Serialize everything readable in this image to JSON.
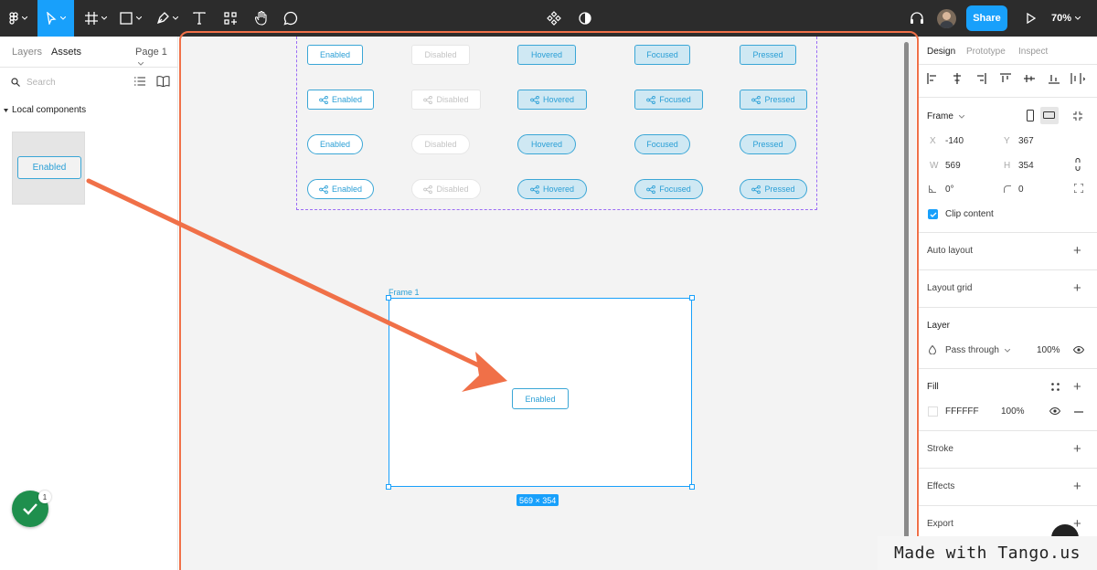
{
  "toolbar": {
    "tools": [
      "figma-menu-icon",
      "move-tool-icon",
      "frame-tool-icon",
      "shape-tool-icon",
      "pen-tool-icon",
      "text-tool-icon",
      "resources-icon",
      "hand-tool-icon",
      "comment-icon"
    ],
    "center_icons": [
      "component-icon",
      "theme-contrast-icon"
    ],
    "share_label": "Share",
    "zoom": "70%"
  },
  "left_panel": {
    "tabs": [
      "Layers",
      "Assets"
    ],
    "page": "Page 1",
    "search_placeholder": "Search",
    "section": "Local components",
    "component_label": "Enabled",
    "notification_count": "1"
  },
  "canvas": {
    "variant_rows": [
      {
        "style": "rect",
        "icon": false,
        "labels": [
          "Enabled",
          "Disabled",
          "Hovered",
          "Focused",
          "Pressed"
        ]
      },
      {
        "style": "rect",
        "icon": true,
        "labels": [
          "Enabled",
          "Disabled",
          "Hovered",
          "Focused",
          "Pressed"
        ]
      },
      {
        "style": "pill",
        "icon": false,
        "labels": [
          "Enabled",
          "Disabled",
          "Hovered",
          "Focused",
          "Pressed"
        ]
      },
      {
        "style": "pill",
        "icon": true,
        "labels": [
          "Enabled",
          "Disabled",
          "Hovered",
          "Focused",
          "Pressed"
        ]
      }
    ],
    "frame_name": "Frame 1",
    "frame_button": "Enabled",
    "frame_dims": "569 × 354"
  },
  "right_panel": {
    "tabs": [
      "Design",
      "Prototype",
      "Inspect"
    ],
    "frame_label": "Frame",
    "x_label": "X",
    "x_value": "-140",
    "y_label": "Y",
    "y_value": "367",
    "w_label": "W",
    "w_value": "569",
    "h_label": "H",
    "h_value": "354",
    "rotation_value": "0°",
    "radius_value": "0",
    "clip_content": "Clip content",
    "sections": {
      "auto_layout": "Auto layout",
      "layout_grid": "Layout grid",
      "layer": "Layer",
      "fill": "Fill",
      "stroke": "Stroke",
      "effects": "Effects",
      "export": "Export"
    },
    "blend_mode": "Pass through",
    "layer_opacity": "100%",
    "fill_hex": "FFFFFF",
    "fill_opacity": "100%"
  },
  "watermark": "Made with Tango.us",
  "colors": {
    "accent": "#18a0fb",
    "highlight": "#f07048",
    "toolbar": "#2c2c2c",
    "component": "#2a9fd6"
  }
}
